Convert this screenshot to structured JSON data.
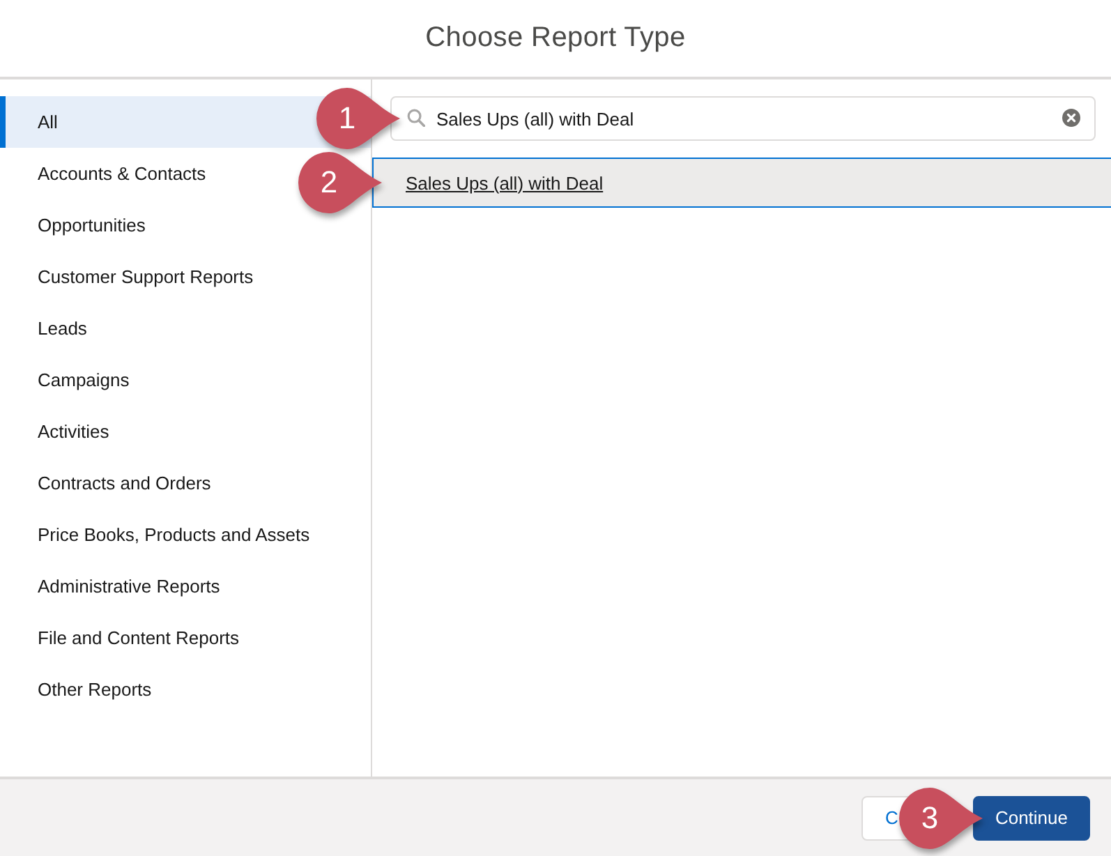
{
  "dialog": {
    "title": "Choose Report Type"
  },
  "sidebar": {
    "items": [
      {
        "label": "All",
        "selected": true
      },
      {
        "label": "Accounts & Contacts",
        "selected": false
      },
      {
        "label": "Opportunities",
        "selected": false
      },
      {
        "label": "Customer Support Reports",
        "selected": false
      },
      {
        "label": "Leads",
        "selected": false
      },
      {
        "label": "Campaigns",
        "selected": false
      },
      {
        "label": "Activities",
        "selected": false
      },
      {
        "label": "Contracts and Orders",
        "selected": false
      },
      {
        "label": "Price Books, Products and Assets",
        "selected": false
      },
      {
        "label": "Administrative Reports",
        "selected": false
      },
      {
        "label": "File and Content Reports",
        "selected": false
      },
      {
        "label": "Other Reports",
        "selected": false
      }
    ]
  },
  "search": {
    "value": "Sales Ups (all) with Deal",
    "callout": "1"
  },
  "results": [
    {
      "label": "Sales Ups (all) with Deal",
      "selected": true,
      "callout": "2"
    }
  ],
  "footer": {
    "buttons": [
      {
        "label": "C",
        "kind": "secondary"
      },
      {
        "label": "Continue",
        "kind": "primary",
        "callout": "3"
      }
    ]
  }
}
